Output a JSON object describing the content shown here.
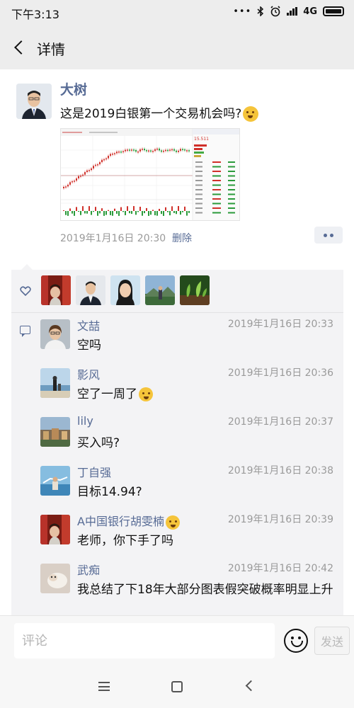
{
  "status_bar": {
    "time": "下午3:13",
    "network": "4G",
    "icons": [
      "signal-dots-icon",
      "bluetooth-icon",
      "alarm-icon",
      "hd-signal-icon",
      "battery-icon"
    ]
  },
  "nav": {
    "title": "详情",
    "back_icon": "chevron-left-icon"
  },
  "post": {
    "author": "大树",
    "text": "这是2019白银第一个交易机会吗?",
    "emoji": "flushed-face-emoji",
    "image": "stock-chart-screenshot",
    "image_header": "15.511",
    "time": "2019年1月16日 20:30",
    "delete_label": "删除",
    "more_icon": "more-dots-icon"
  },
  "likes": {
    "icon": "heart-icon",
    "avatars": [
      "avatar-red-interior",
      "avatar-man-suit",
      "avatar-woman",
      "avatar-outdoor-person",
      "avatar-plant"
    ]
  },
  "comments": [
    {
      "name": "文喆",
      "time": "2019年1月16日 20:33",
      "text": "空吗",
      "emoji": ""
    },
    {
      "name": "影风",
      "time": "2019年1月16日 20:36",
      "text": "空了一周了",
      "emoji": "laughing-tears-emoji"
    },
    {
      "name": "lily",
      "time": "2019年1月16日 20:37",
      "text": "买入吗?",
      "emoji": ""
    },
    {
      "name": "丁自强",
      "time": "2019年1月16日 20:38",
      "text": "目标14.94?",
      "emoji": ""
    },
    {
      "name": "A中国银行胡雯楠",
      "time": "2019年1月16日 20:39",
      "text": "老师，你下手了吗",
      "emoji": "kiss-face-emoji"
    },
    {
      "name": "武痴",
      "time": "2019年1月16日 20:42",
      "text": "我总结了下18年大部分图表假突破概率明显上升",
      "emoji": ""
    }
  ],
  "input": {
    "placeholder": "评论",
    "value": "",
    "send_label": "发送",
    "emoji_icon": "smiley-icon"
  },
  "system_nav": [
    "menu-icon",
    "home-icon",
    "back-icon"
  ],
  "colors": {
    "link": "#576b95",
    "panel_bg": "#f3f3f5",
    "header_bg": "#ededed"
  }
}
